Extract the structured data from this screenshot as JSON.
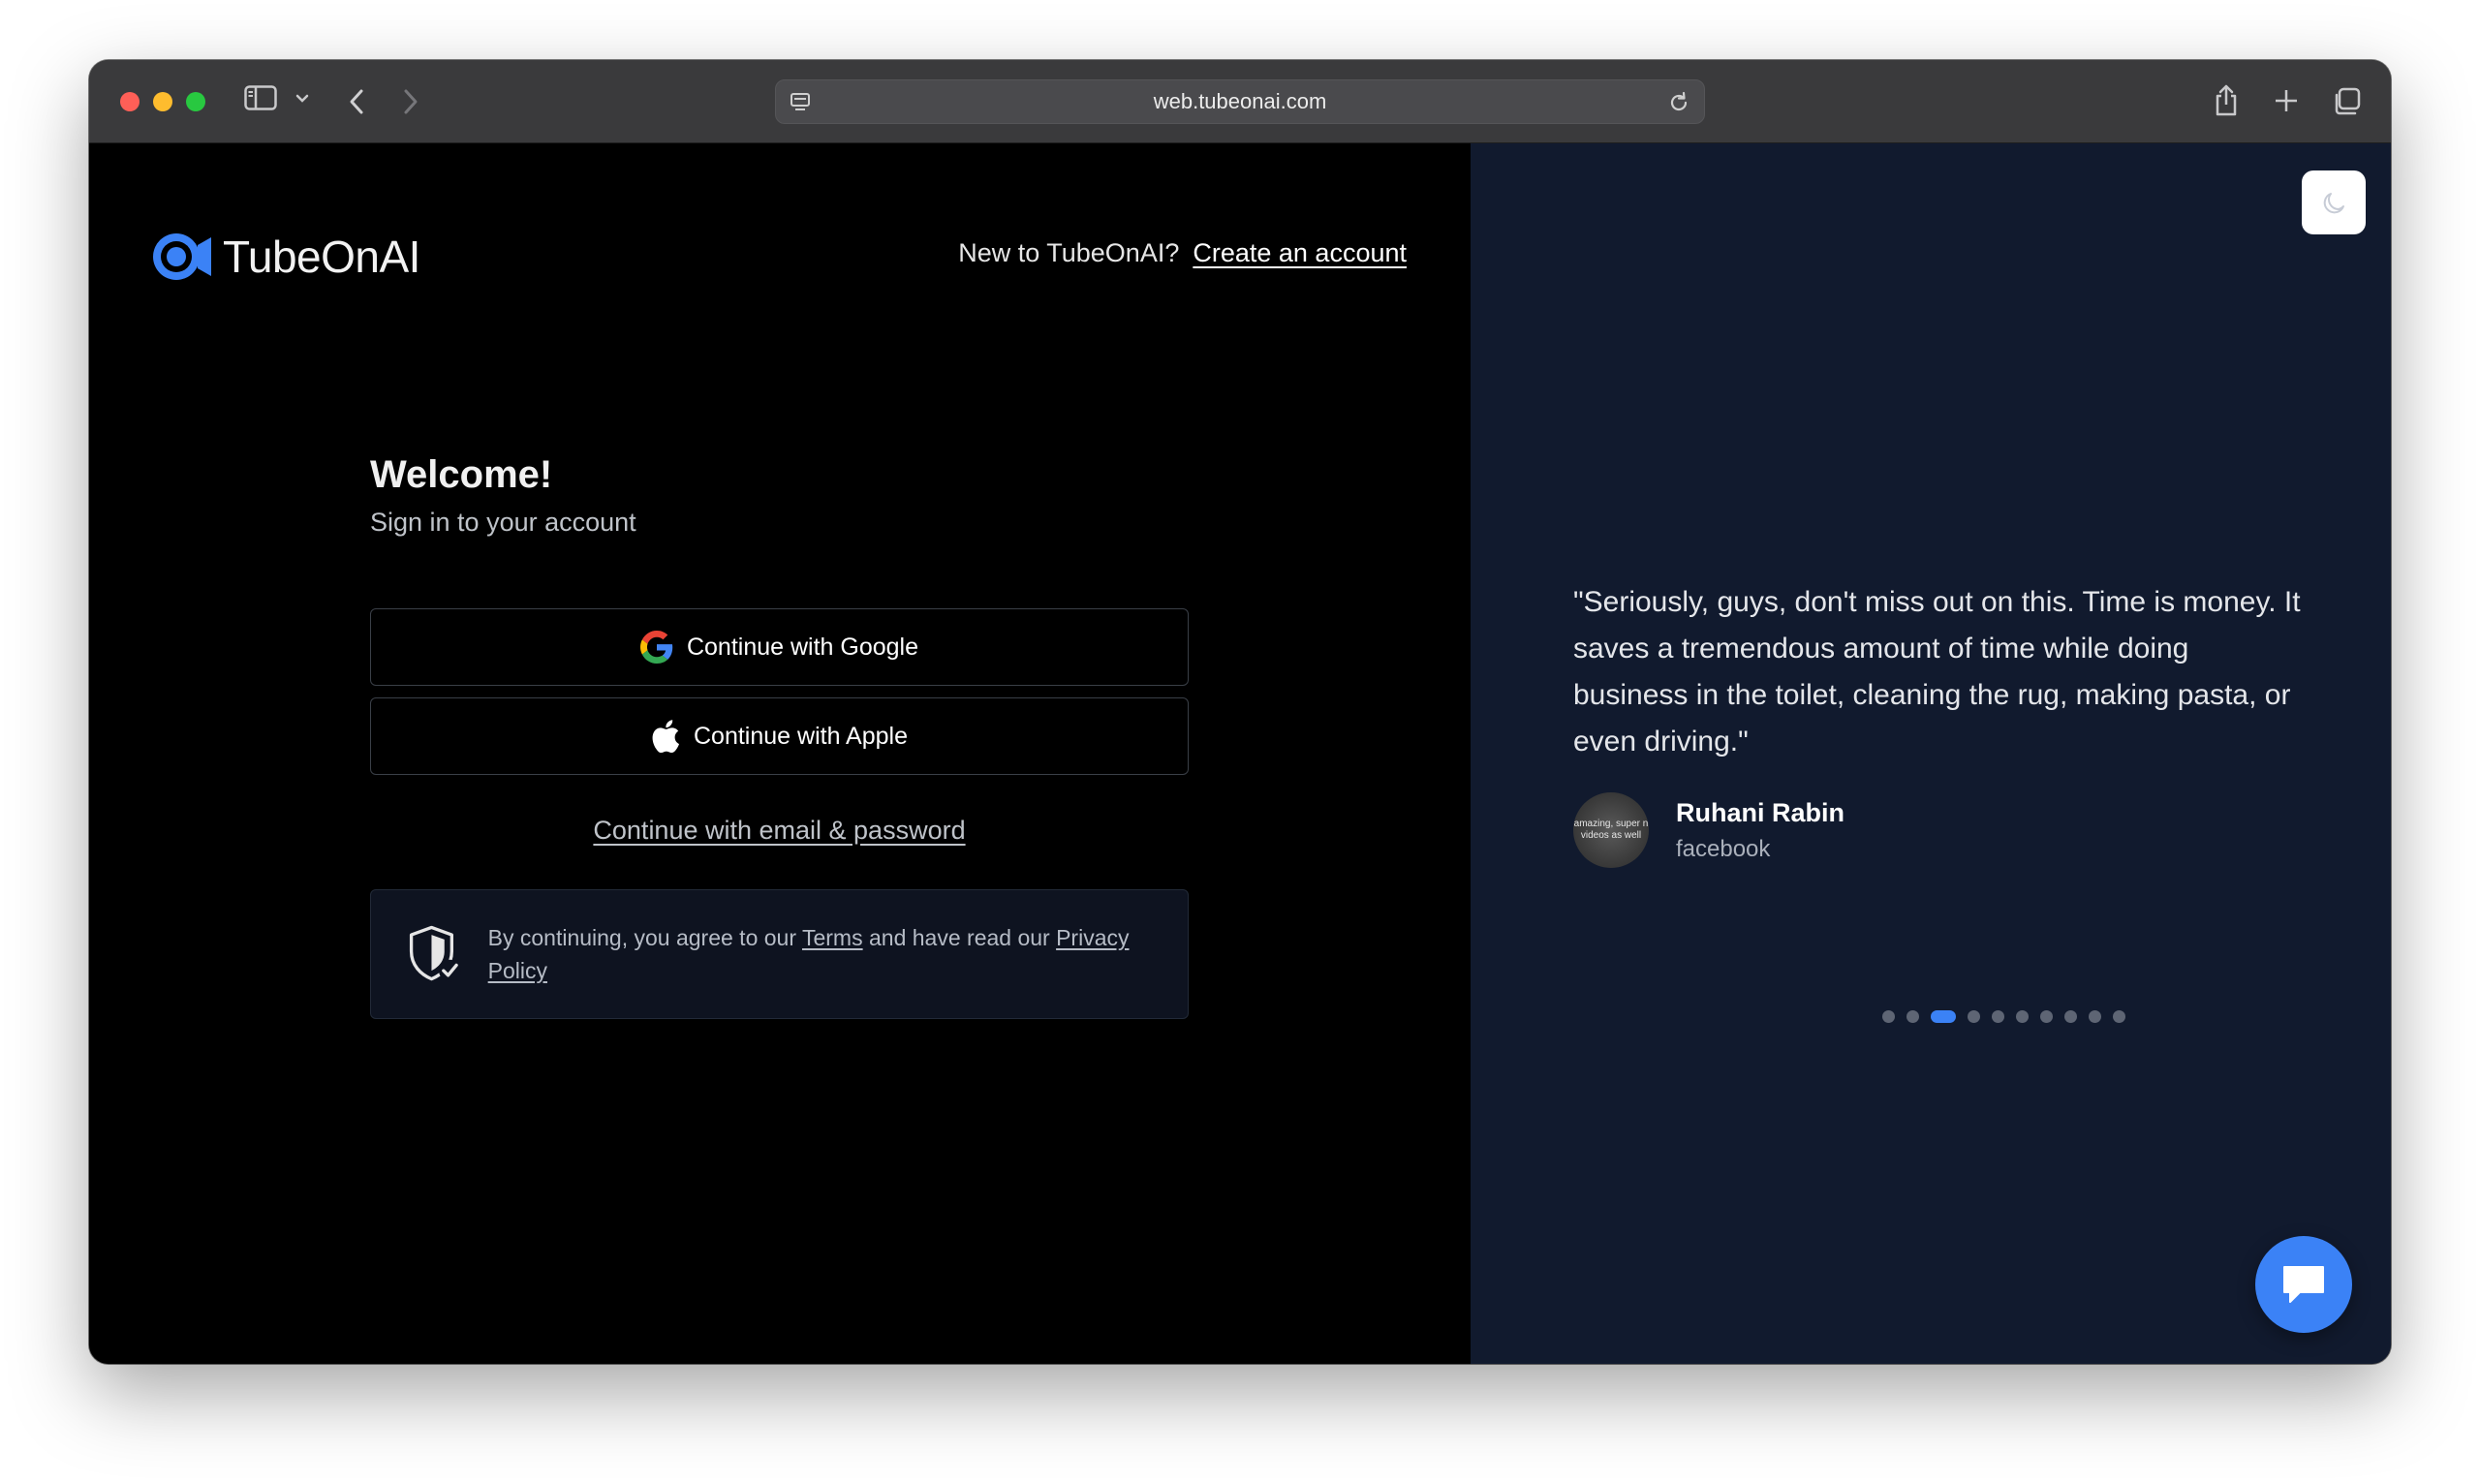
{
  "browser": {
    "url": "web.tubeonai.com"
  },
  "header": {
    "logo_text": "TubeOnAI",
    "signup_prompt": "New to TubeOnAI?",
    "signup_link": "Create an account"
  },
  "signin": {
    "title": "Welcome!",
    "subtitle": "Sign in to your account",
    "google_label": "Continue with Google",
    "apple_label": "Continue with Apple",
    "email_label": "Continue with email & password",
    "terms": {
      "prefix": "By continuing, you agree to our",
      "terms_link": "Terms",
      "middle": "and have read our",
      "privacy_link": "Privacy Policy"
    }
  },
  "testimonial": {
    "quote": "\"Seriously, guys, don't miss out on this. Time is money. It saves a tremendous amount of time while doing business in the toilet, cleaning the rug, making pasta, or even driving.\"",
    "author_name": "Ruhani Rabin",
    "author_source": "facebook",
    "avatar_text": "amazing, super n videos as well",
    "slides_total": 10,
    "active_slide": 3
  },
  "colors": {
    "accent": "#3b82f6",
    "right_panel_bg": "#111a2e",
    "left_panel_bg": "#000000"
  },
  "icons": {
    "theme_toggle": "moon-icon",
    "chat": "chat-bubble-icon",
    "shield": "shield-check-icon"
  }
}
